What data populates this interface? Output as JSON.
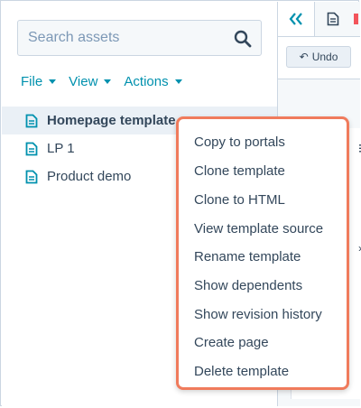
{
  "search": {
    "placeholder": "Search assets"
  },
  "toolbar_menus": [
    {
      "label": "File"
    },
    {
      "label": "View"
    },
    {
      "label": "Actions"
    }
  ],
  "tree": {
    "items": [
      {
        "label": "Homepage template",
        "selected": true
      },
      {
        "label": "LP 1",
        "selected": false
      },
      {
        "label": "Product demo",
        "selected": false
      }
    ]
  },
  "editor": {
    "undo_label": "Undo"
  },
  "context_menu": {
    "items": [
      {
        "label": "Copy to portals"
      },
      {
        "label": "Clone template"
      },
      {
        "label": "Clone to HTML"
      },
      {
        "label": "View template source"
      },
      {
        "label": "Rename template"
      },
      {
        "label": "Show dependents"
      },
      {
        "label": "Show revision history"
      },
      {
        "label": "Create page"
      },
      {
        "label": "Delete template"
      }
    ]
  },
  "colors": {
    "accent": "#0091ae",
    "text": "#33475b",
    "border": "#cbd6e2",
    "highlight": "#f07b5c",
    "selected_bg": "#eaf0f6"
  },
  "icons": {
    "search": "search-icon",
    "file": "file-icon",
    "collapse": "double-chevron-left-icon",
    "undo": "undo-icon"
  }
}
